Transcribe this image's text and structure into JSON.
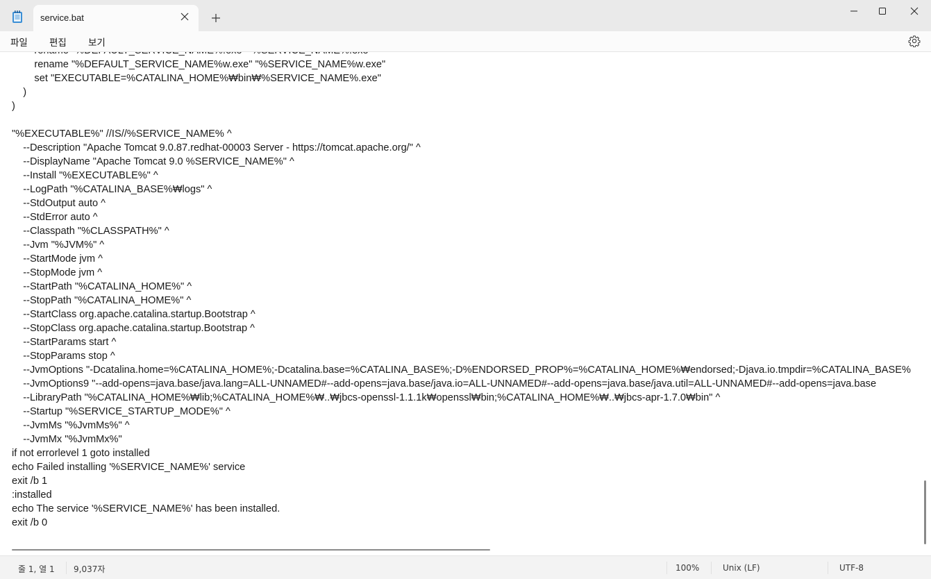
{
  "window": {
    "tab_title": "service.bat",
    "new_tab_symbol": "+",
    "minimize_symbol": "—",
    "maximize_symbol": "□",
    "close_symbol": "✕"
  },
  "menu": {
    "items": [
      "파일",
      "편집",
      "보기"
    ],
    "settings_icon": "gear-icon"
  },
  "editor": {
    "lines": [
      "        rename \"%DEFAULT_SERVICE_NAME%.exe\" \"%SERVICE_NAME%.exe\"",
      "        rename \"%DEFAULT_SERVICE_NAME%w.exe\" \"%SERVICE_NAME%w.exe\"",
      "        set \"EXECUTABLE=%CATALINA_HOME%₩bin₩%SERVICE_NAME%.exe\"",
      "    )",
      ")",
      "",
      "\"%EXECUTABLE%\" //IS//%SERVICE_NAME% ^",
      "    --Description \"Apache Tomcat 9.0.87.redhat-00003 Server - https://tomcat.apache.org/\" ^",
      "    --DisplayName \"Apache Tomcat 9.0 %SERVICE_NAME%\" ^",
      "    --Install \"%EXECUTABLE%\" ^",
      "    --LogPath \"%CATALINA_BASE%₩logs\" ^",
      "    --StdOutput auto ^",
      "    --StdError auto ^",
      "    --Classpath \"%CLASSPATH%\" ^",
      "    --Jvm \"%JVM%\" ^",
      "    --StartMode jvm ^",
      "    --StopMode jvm ^",
      "    --StartPath \"%CATALINA_HOME%\" ^",
      "    --StopPath \"%CATALINA_HOME%\" ^",
      "    --StartClass org.apache.catalina.startup.Bootstrap ^",
      "    --StopClass org.apache.catalina.startup.Bootstrap ^",
      "    --StartParams start ^",
      "    --StopParams stop ^",
      "    --JvmOptions \"-Dcatalina.home=%CATALINA_HOME%;-Dcatalina.base=%CATALINA_BASE%;-D%ENDORSED_PROP%=%CATALINA_HOME%₩endorsed;-Djava.io.tmpdir=%CATALINA_BASE%",
      "    --JvmOptions9 \"--add-opens=java.base/java.lang=ALL-UNNAMED#--add-opens=java.base/java.io=ALL-UNNAMED#--add-opens=java.base/java.util=ALL-UNNAMED#--add-opens=java.base",
      "    --LibraryPath \"%CATALINA_HOME%₩lib;%CATALINA_HOME%₩..₩jbcs-openssl-1.1.1k₩openssl₩bin;%CATALINA_HOME%₩..₩jbcs-apr-1.7.0₩bin\" ^",
      "    --Startup \"%SERVICE_STARTUP_MODE%\" ^",
      "    --JvmMs \"%JvmMs%\" ^",
      "    --JvmMx \"%JvmMx%\"",
      "if not errorlevel 1 goto installed",
      "echo Failed installing '%SERVICE_NAME%' service",
      "exit /b 1",
      ":installed",
      "echo The service '%SERVICE_NAME%' has been installed.",
      "exit /b 0"
    ]
  },
  "status": {
    "position": "줄 1, 열 1",
    "char_count": "9,037자",
    "zoom": "100%",
    "line_ending": "Unix (LF)",
    "encoding": "UTF-8"
  }
}
